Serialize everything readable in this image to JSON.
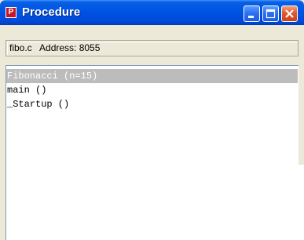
{
  "window": {
    "title": "Procedure",
    "app_icon_letter": "P"
  },
  "address": {
    "text": "fibo.c   Address: 8055"
  },
  "procedures": [
    {
      "label": "Fibonacci (n=15)",
      "selected": true
    },
    {
      "label": "main ()",
      "selected": false
    },
    {
      "label": "_Startup ()",
      "selected": false
    }
  ],
  "colors": {
    "titlebar": "#0055e5",
    "selection": "#bcbcbc",
    "close_button": "#e3582f"
  },
  "icons": {
    "minimize": "minimize-icon",
    "maximize": "maximize-icon",
    "close": "close-icon"
  }
}
